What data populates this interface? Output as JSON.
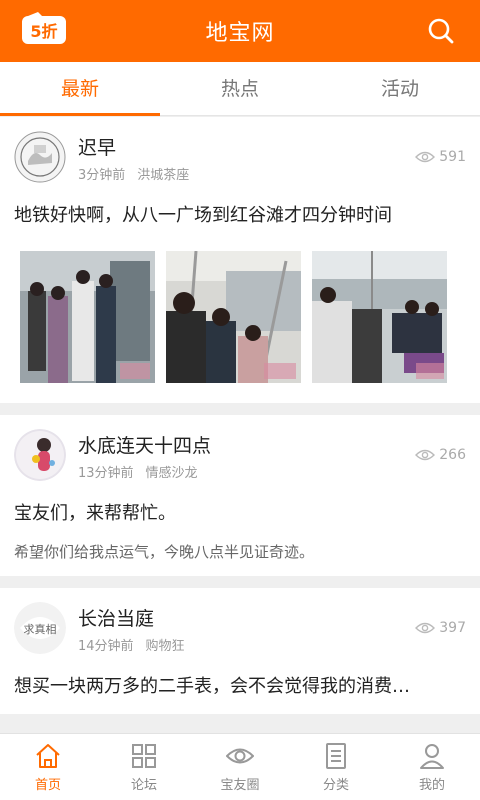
{
  "header": {
    "title": "地宝网",
    "logo_text": "5折"
  },
  "tabs": [
    {
      "label": "最新",
      "active": true
    },
    {
      "label": "热点",
      "active": false
    },
    {
      "label": "活动",
      "active": false
    }
  ],
  "posts": [
    {
      "author": "迟早",
      "time": "3分钟前",
      "forum": "洪城茶座",
      "views": "591",
      "title": "地铁好快啊，从八一广场到红谷滩才四分钟时间"
    },
    {
      "author": "水底连天十四点",
      "time": "13分钟前",
      "forum": "情感沙龙",
      "views": "266",
      "title": "宝友们，来帮帮忙。",
      "excerpt": "希望你们给我点运气，今晚八点半见证奇迹。"
    },
    {
      "author": "长治当庭",
      "time": "14分钟前",
      "forum": "购物狂",
      "views": "397",
      "title": "想买一块两万多的二手表，会不会觉得我的消费…",
      "avatar_text": "求真相"
    }
  ],
  "bottom_nav": [
    {
      "label": "首页",
      "icon": "home-icon",
      "active": true
    },
    {
      "label": "论坛",
      "icon": "grid-icon",
      "active": false
    },
    {
      "label": "宝友圈",
      "icon": "eye-icon",
      "active": false
    },
    {
      "label": "分类",
      "icon": "list-icon",
      "active": false
    },
    {
      "label": "我的",
      "icon": "user-icon",
      "active": false
    }
  ],
  "colors": {
    "accent": "#ff6a00",
    "background": "#efefef"
  }
}
